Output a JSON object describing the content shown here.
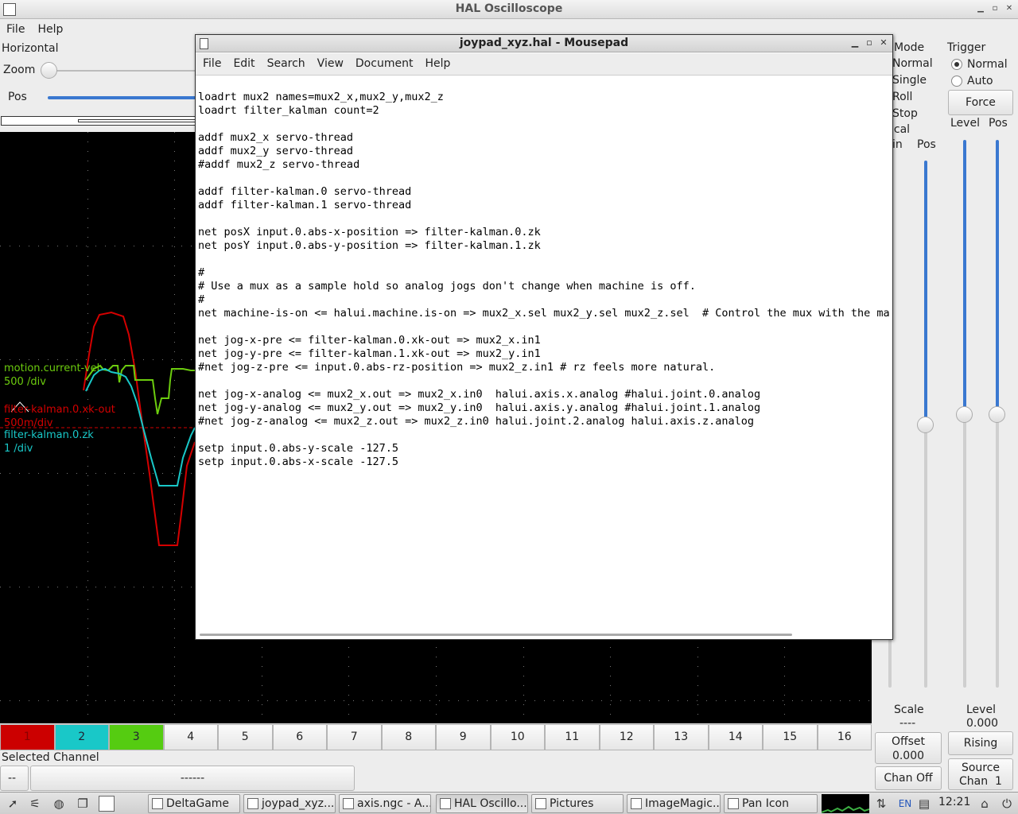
{
  "window": {
    "title": "HAL Oscilloscope",
    "minimize": "▁",
    "maximize": "▫",
    "close": "✕"
  },
  "menu": [
    "File",
    "Help"
  ],
  "horizontal": {
    "title": "Horizontal",
    "zoom_label": "Zoom",
    "pos_label": "Pos"
  },
  "traces": [
    {
      "label": "motion.current-vel",
      "scale": "500 /div",
      "color": "#6ccc0e"
    },
    {
      "label": "filter-kalman.0.xk-out",
      "scale": "500m/div",
      "color": "#d40000"
    },
    {
      "label": "filter-kalman.0.zk",
      "scale": "1 /div",
      "color": "#19c8c8"
    }
  ],
  "run_mode": {
    "title": "Mode",
    "items": [
      "Normal",
      "Single",
      "Roll",
      "Stop"
    ]
  },
  "vertical": {
    "title": "ical",
    "gain_label": "in",
    "pos_label": "Pos",
    "scale_label": "Scale",
    "scale_value": "----",
    "offset_label": "Offset",
    "offset_value": "0.000",
    "chan_off": "Chan Off"
  },
  "trigger": {
    "title": "Trigger",
    "normal": "Normal",
    "auto": "Auto",
    "force": "Force",
    "level_label": "Level",
    "pos_label": "Pos",
    "level_text": "Level",
    "level_value": "0.000",
    "edge": "Rising",
    "source": "Source",
    "source_chan": "Chan  1"
  },
  "channels": [
    "1",
    "2",
    "3",
    "4",
    "5",
    "6",
    "7",
    "8",
    "9",
    "10",
    "11",
    "12",
    "13",
    "14",
    "15",
    "16"
  ],
  "channel_colors": {
    "1": "#cc0000",
    "2": "#19c8c8",
    "3": "#55cc11"
  },
  "selected_channel": {
    "label": "Selected Channel",
    "button": "--",
    "field": "------"
  },
  "mousepad": {
    "title": "joypad_xyz.hal - Mousepad",
    "menu": [
      "File",
      "Edit",
      "Search",
      "View",
      "Document",
      "Help"
    ],
    "lines": [
      "loadrt mux2 names=mux2_x,mux2_y,mux2_z",
      "loadrt filter_kalman count=2",
      "",
      "addf mux2_x servo-thread",
      "addf mux2_y servo-thread",
      "#addf mux2_z servo-thread",
      "",
      "addf filter-kalman.0 servo-thread",
      "addf filter-kalman.1 servo-thread",
      "",
      "net posX input.0.abs-x-position => filter-kalman.0.zk",
      "net posY input.0.abs-y-position => filter-kalman.1.zk",
      "",
      "#",
      "# Use a mux as a sample hold so analog jogs don't change when machine is off.",
      "#",
      "net machine-is-on <= halui.machine.is-on => mux2_x.sel mux2_y.sel mux2_z.sel  # Control the mux with the mach",
      "",
      "net jog-x-pre <= filter-kalman.0.xk-out => mux2_x.in1",
      "net jog-y-pre <= filter-kalman.1.xk-out => mux2_y.in1",
      "#net jog-z-pre <= input.0.abs-rz-position => mux2_z.in1 # rz feels more natural.",
      "",
      "net jog-x-analog <= mux2_x.out => mux2_x.in0  halui.axis.x.analog #halui.joint.0.analog",
      "net jog-y-analog <= mux2_y.out => mux2_y.in0  halui.axis.y.analog #halui.joint.1.analog",
      "#net jog-z-analog <= mux2_z.out => mux2_z.in0 halui.joint.2.analog halui.axis.z.analog",
      "",
      "setp input.0.abs-y-scale -127.5",
      "setp input.0.abs-x-scale -127.5"
    ]
  },
  "taskbar": {
    "tasks": [
      "DeltaGame",
      "joypad_xyz....",
      "axis.ngc - A...",
      "HAL Oscillo...",
      "Pictures",
      "ImageMagic...",
      "Pan Icon"
    ],
    "keyboard": "EN",
    "clock": "12:21"
  }
}
